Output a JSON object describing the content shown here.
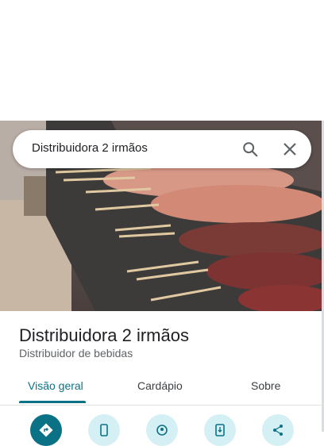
{
  "search": {
    "query": "Distribuidora 2 irmãos"
  },
  "place": {
    "name": "Distribuidora 2 irmãos",
    "category": "Distribuidor de bebidas"
  },
  "tabs": [
    {
      "label": "Visão geral",
      "active": true
    },
    {
      "label": "Cardápio",
      "active": false
    },
    {
      "label": "Sobre",
      "active": false
    }
  ],
  "actions": [
    {
      "icon": "directions-icon"
    },
    {
      "icon": "phone-icon"
    },
    {
      "icon": "nearby-icon"
    },
    {
      "icon": "save-to-phone-icon"
    },
    {
      "icon": "share-icon"
    }
  ],
  "colors": {
    "accent": "#0b7285",
    "action_bg": "#d4f0f4",
    "text": "#202124",
    "subtext": "#5f6368"
  }
}
